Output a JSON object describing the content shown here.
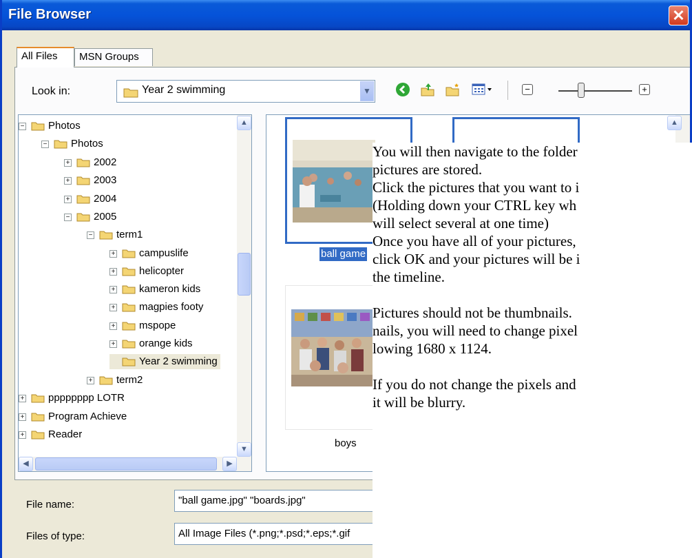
{
  "window": {
    "title": "File Browser",
    "close_symbol": "✕"
  },
  "tabs": [
    {
      "label": "All Files"
    },
    {
      "label": "MSN Groups"
    }
  ],
  "look_in": {
    "label": "Look in:",
    "value": "Year 2 swimming"
  },
  "toolbar": {
    "back_icon": "back-arrow-icon",
    "up_icon": "up-folder-icon",
    "new_folder_icon": "new-folder-icon",
    "views_icon": "views-menu-icon",
    "zoom_minus": "−",
    "zoom_plus": "+"
  },
  "tree": {
    "nodes": [
      {
        "label": "Photos",
        "expander": "−"
      },
      {
        "label": "Photos",
        "expander": "−"
      },
      {
        "label": "2002",
        "expander": "+"
      },
      {
        "label": "2003",
        "expander": "+"
      },
      {
        "label": "2004",
        "expander": "+"
      },
      {
        "label": "2005",
        "expander": "−"
      },
      {
        "label": "term1",
        "expander": "−"
      },
      {
        "label": "campuslife",
        "expander": "+"
      },
      {
        "label": "helicopter",
        "expander": "+"
      },
      {
        "label": "kameron kids",
        "expander": "+"
      },
      {
        "label": "magpies footy",
        "expander": "+"
      },
      {
        "label": "mspope",
        "expander": "+"
      },
      {
        "label": "orange kids",
        "expander": "+"
      },
      {
        "label": "Year 2 swimming",
        "expander": ""
      },
      {
        "label": "term2",
        "expander": "+"
      },
      {
        "label": "pppppppp LOTR",
        "expander": "+"
      },
      {
        "label": "Program Achieve",
        "expander": "+"
      },
      {
        "label": "Reader",
        "expander": "+"
      }
    ]
  },
  "thumbnails": [
    {
      "caption": "ball game"
    },
    {
      "caption": "boys"
    }
  ],
  "bottom": {
    "file_name_label": "File name:",
    "file_name_value": "\"ball game.jpg\" \"boards.jpg\"",
    "file_type_label": "Files of type:",
    "file_type_value": "All Image Files (*.png;*.psd;*.eps;*.gif"
  },
  "overlay_lines": [
    "You will then navigate to the folder",
    "pictures are stored.",
    "Click the pictures that you want to i",
    "(Holding down your CTRL key wh",
    "will select several at one time)",
    "Once you have all of your pictures,",
    "click OK and your pictures will be i",
    "the timeline.",
    "",
    "Pictures should not be thumbnails.",
    "nails, you will need to change pixel",
    "lowing 1680 x 1124.",
    "",
    "If you do not change the pixels and",
    "it will be blurry."
  ]
}
